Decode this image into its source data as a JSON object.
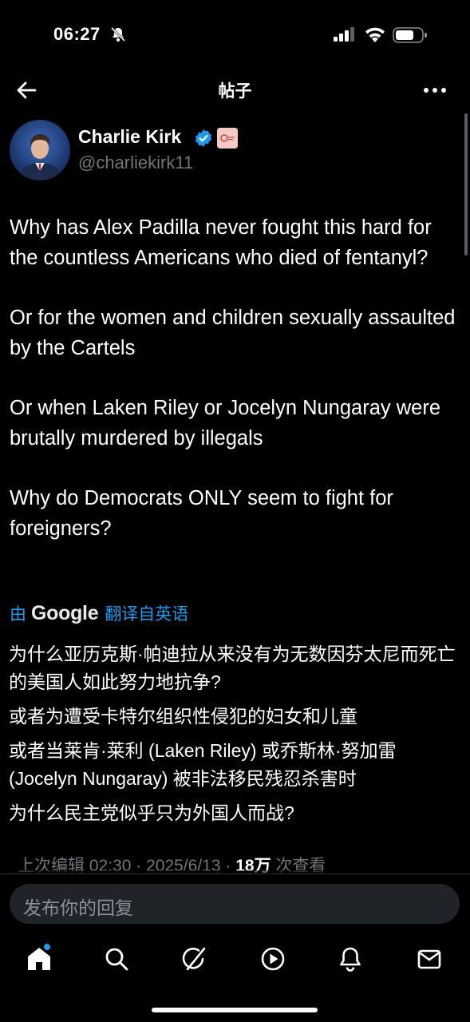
{
  "status_bar": {
    "time": "06:27"
  },
  "nav": {
    "title": "帖子"
  },
  "author": {
    "display_name": "Charlie Kirk",
    "handle": "@charliekirk11",
    "verified_color": "#1d9bf0"
  },
  "post": {
    "paragraphs": [
      "Why has Alex Padilla never fought this hard for the countless Americans who died of fentanyl?",
      "Or for the women and children sexually assaulted by the Cartels",
      "Or when Laken Riley or Jocelyn Nungaray were brutally murdered by illegals",
      "Why do Democrats ONLY seem to fight for foreigners?"
    ]
  },
  "translation": {
    "by": "由",
    "provider": "Google",
    "from_label": "翻译自英语",
    "paragraphs": [
      "为什么亚历克斯·帕迪拉从来没有为无数因芬太尼而死亡的美国人如此努力地抗争?",
      "或者为遭受卡特尔组织性侵犯的妇女和儿童",
      "或者当莱肯·莱利 (Laken Riley) 或乔斯林·努加雷 (Jocelyn Nungaray) 被非法移民残忍杀害时",
      "为什么民主党似乎只为外国人而战?"
    ]
  },
  "meta": {
    "edited_label": "上次编辑",
    "time": "02:30",
    "separator": "·",
    "date": "2025/6/13",
    "views_count": "18万",
    "views_label": "次查看"
  },
  "reply": {
    "placeholder": "发布你的回复"
  },
  "tabs": [
    {
      "icon": "home-icon",
      "active": true
    },
    {
      "icon": "search-icon"
    },
    {
      "icon": "grok-icon"
    },
    {
      "icon": "video-icon"
    },
    {
      "icon": "notifications-icon"
    },
    {
      "icon": "messages-icon"
    }
  ],
  "colors": {
    "background": "#000000",
    "accent": "#1d9bf0",
    "secondary_text": "#71767b"
  }
}
